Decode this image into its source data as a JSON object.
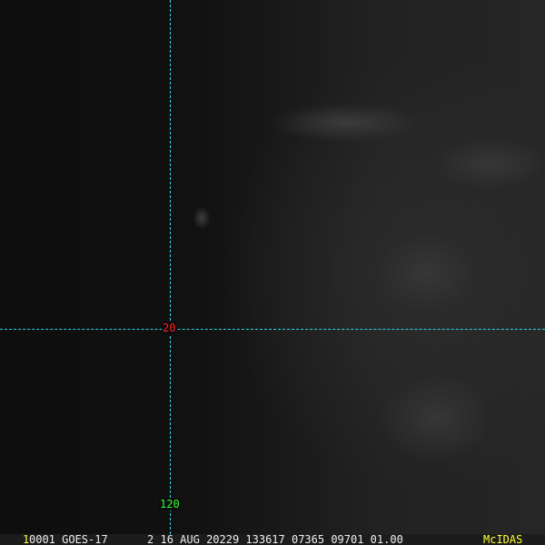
{
  "overlay": {
    "latitude_label": "20",
    "longitude_label": "120"
  },
  "status_bar": {
    "frame_number": "1",
    "info_text": "0001 GOES-17      2 16 AUG 20229 133617 07365 09701 01.00",
    "brand": "McIDAS"
  },
  "colors": {
    "grid_line": "#3ad4e6",
    "latitude_label": "#ff2020",
    "longitude_label": "#33ff33",
    "brand": "#ffff30"
  }
}
